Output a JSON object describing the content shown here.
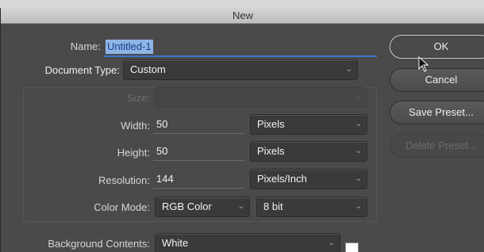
{
  "window": {
    "title": "New"
  },
  "name": {
    "label": "Name:",
    "value": "Untitled-1"
  },
  "document_type": {
    "label": "Document Type:",
    "value": "Custom"
  },
  "size": {
    "label": "Size:",
    "value": ""
  },
  "width": {
    "label": "Width:",
    "value": "50",
    "unit": "Pixels"
  },
  "height": {
    "label": "Height:",
    "value": "50",
    "unit": "Pixels"
  },
  "resolution": {
    "label": "Resolution:",
    "value": "144",
    "unit": "Pixels/Inch"
  },
  "color_mode": {
    "label": "Color Mode:",
    "mode": "RGB Color",
    "depth": "8 bit"
  },
  "background": {
    "label": "Background Contents:",
    "value": "White",
    "swatch_color": "#ffffff"
  },
  "buttons": {
    "ok": "OK",
    "cancel": "Cancel",
    "save_preset": "Save Preset...",
    "delete_preset": "Delete Preset..."
  }
}
